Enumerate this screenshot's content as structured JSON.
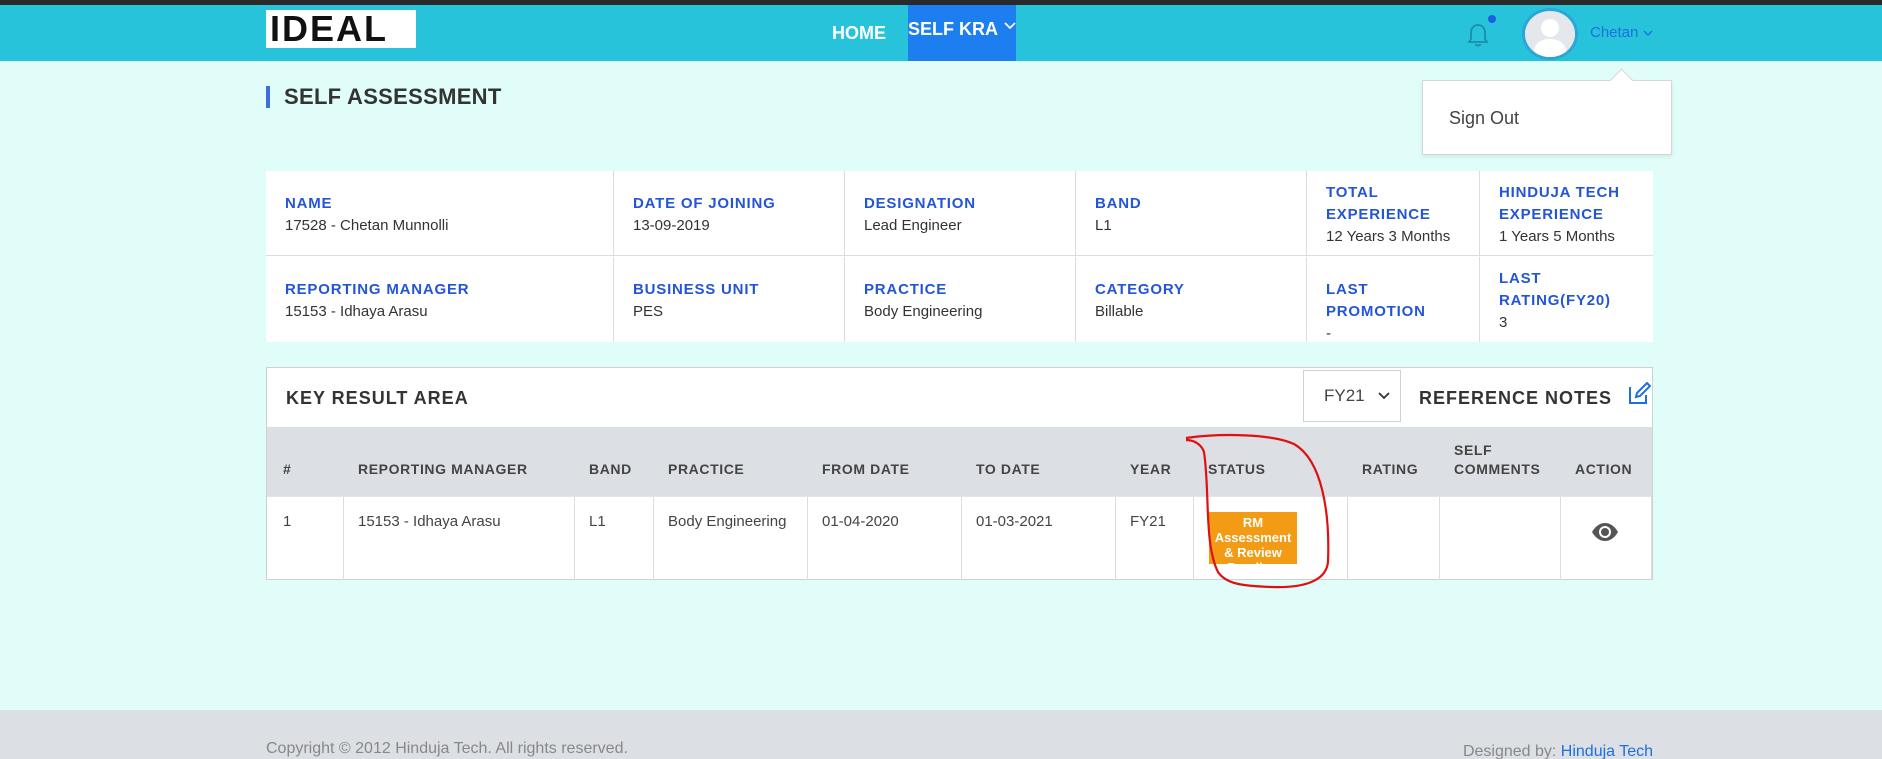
{
  "brand": {
    "logo_text": "IDEAL"
  },
  "nav": {
    "home_label": "HOME",
    "selfkra_label": "SELF KRA"
  },
  "user": {
    "name": "Chetan",
    "dropdown_item": "Sign Out"
  },
  "page": {
    "title": "SELF ASSESSMENT"
  },
  "info": {
    "row1": [
      {
        "label": "NAME",
        "value": "17528 - Chetan Munnolli"
      },
      {
        "label": "DATE OF JOINING",
        "value": "13-09-2019"
      },
      {
        "label": "DESIGNATION",
        "value": "Lead Engineer"
      },
      {
        "label": "BAND",
        "value": "L1"
      },
      {
        "label": "TOTAL EXPERIENCE",
        "value": "12 Years 3 Months"
      },
      {
        "label": "HINDUJA TECH EXPERIENCE",
        "value": "1 Years 5 Months"
      }
    ],
    "row2": [
      {
        "label": "REPORTING MANAGER",
        "value": "15153 - Idhaya Arasu"
      },
      {
        "label": "BUSINESS UNIT",
        "value": "PES"
      },
      {
        "label": "PRACTICE",
        "value": "Body Engineering"
      },
      {
        "label": "CATEGORY",
        "value": "Billable"
      },
      {
        "label": "LAST PROMOTION",
        "value": "-"
      },
      {
        "label": "LAST RATING(FY20)",
        "value": "3"
      }
    ]
  },
  "kra": {
    "title": "KEY RESULT AREA",
    "year_select": "FY21",
    "reference_notes": "REFERENCE NOTES",
    "columns": [
      "#",
      "REPORTING MANAGER",
      "BAND",
      "PRACTICE",
      "FROM DATE",
      "TO DATE",
      "YEAR",
      "STATUS",
      "RATING",
      "SELF COMMENTS",
      "ACTION"
    ],
    "rows": [
      {
        "index": "1",
        "manager": "15153 - Idhaya Arasu",
        "band": "L1",
        "practice": "Body Engineering",
        "from": "01-04-2020",
        "to": "01-03-2021",
        "year": "FY21",
        "status": "RM Assessment & Review Pending",
        "rating": "",
        "comments": ""
      }
    ],
    "status_color": "#f39b15"
  },
  "footer": {
    "copyright": "Copyright © 2012 Hinduja Tech. All rights reserved.",
    "designed_by_label": "Designed by:",
    "designed_by_link": "Hinduja Tech"
  },
  "colors": {
    "navbar": "#26c3da",
    "active_nav": "#1d7ef0",
    "page_bg": "#e0fdfa",
    "label_blue": "#2455d6"
  }
}
